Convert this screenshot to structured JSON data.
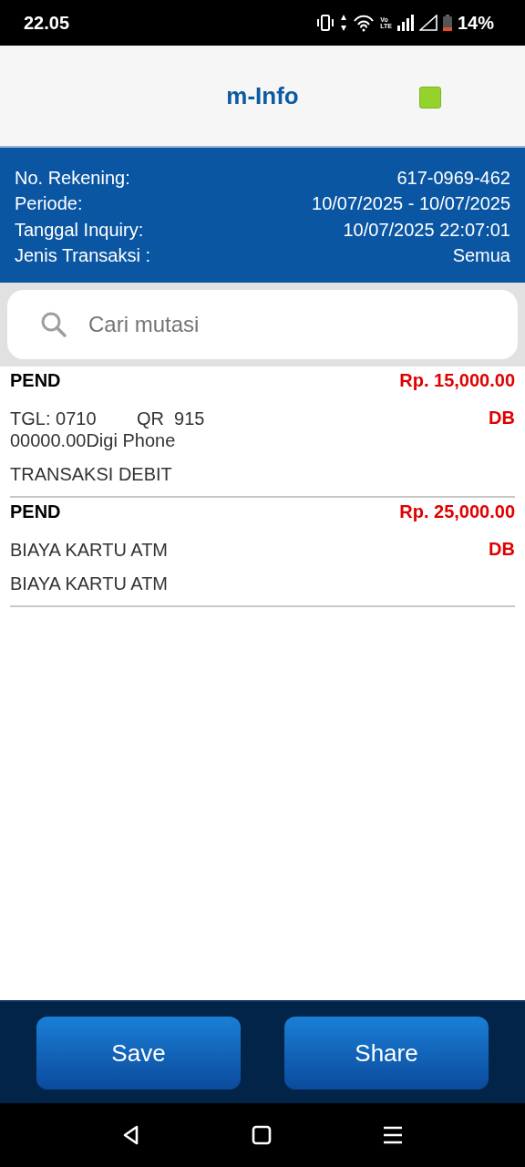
{
  "status_bar": {
    "time": "22.05",
    "network_label": [
      "Vo",
      "LTE"
    ],
    "battery": "14%"
  },
  "header": {
    "title": "m-Info"
  },
  "account_info": [
    {
      "label": "No. Rekening:",
      "value": "617-0969-462"
    },
    {
      "label": "Periode:",
      "value": "10/07/2025 - 10/07/2025"
    },
    {
      "label": "Tanggal Inquiry:",
      "value": "10/07/2025 22:07:01"
    },
    {
      "label": "Jenis Transaksi :",
      "value": "Semua"
    }
  ],
  "search": {
    "placeholder": "Cari mutasi"
  },
  "transactions": [
    {
      "status": "PEND",
      "amount": "Rp. 15,000.00",
      "description": "TGL: 0710        QR  915\n00000.00Digi Phone",
      "type": "DB",
      "remark": "TRANSAKSI DEBIT"
    },
    {
      "status": "PEND",
      "amount": "Rp. 25,000.00",
      "description": "BIAYA KARTU ATM",
      "type": "DB",
      "remark": "BIAYA KARTU ATM"
    }
  ],
  "buttons": [
    "Save",
    "Share"
  ]
}
